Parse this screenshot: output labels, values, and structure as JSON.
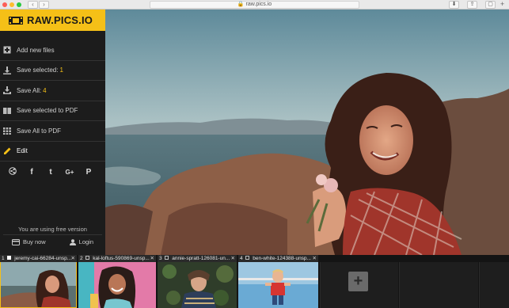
{
  "browser": {
    "url": "raw.pics.io",
    "back_icon": "chevron-left",
    "forward_icon": "chevron-right"
  },
  "brand": {
    "name": "RAW.PICS.IO",
    "accent": "#f5c017"
  },
  "menu": {
    "add_new_files": "Add new files",
    "save_selected_label": "Save selected:",
    "save_selected_count": "1",
    "save_all_label": "Save All:",
    "save_all_count": "4",
    "save_selected_pdf": "Save selected to PDF",
    "save_all_pdf": "Save All to PDF",
    "edit": "Edit"
  },
  "social": {
    "facebook": "f",
    "tumblr": "t",
    "google": "G+",
    "pinterest": "P"
  },
  "footer": {
    "free_note": "You are using free version",
    "buy_now": "Buy now",
    "login": "Login"
  },
  "filmstrip": {
    "items": [
      {
        "index": "1",
        "name": "jeremy-cai-66284-unsp...",
        "active": true
      },
      {
        "index": "2",
        "name": "kal-loftus-590869-unsp...",
        "active": false
      },
      {
        "index": "3",
        "name": "annie-spratt-126081-un...",
        "active": false
      },
      {
        "index": "4",
        "name": "ben-white-124388-unsp...",
        "active": false
      }
    ],
    "close_symbol": "✕",
    "add_symbol": "+"
  }
}
